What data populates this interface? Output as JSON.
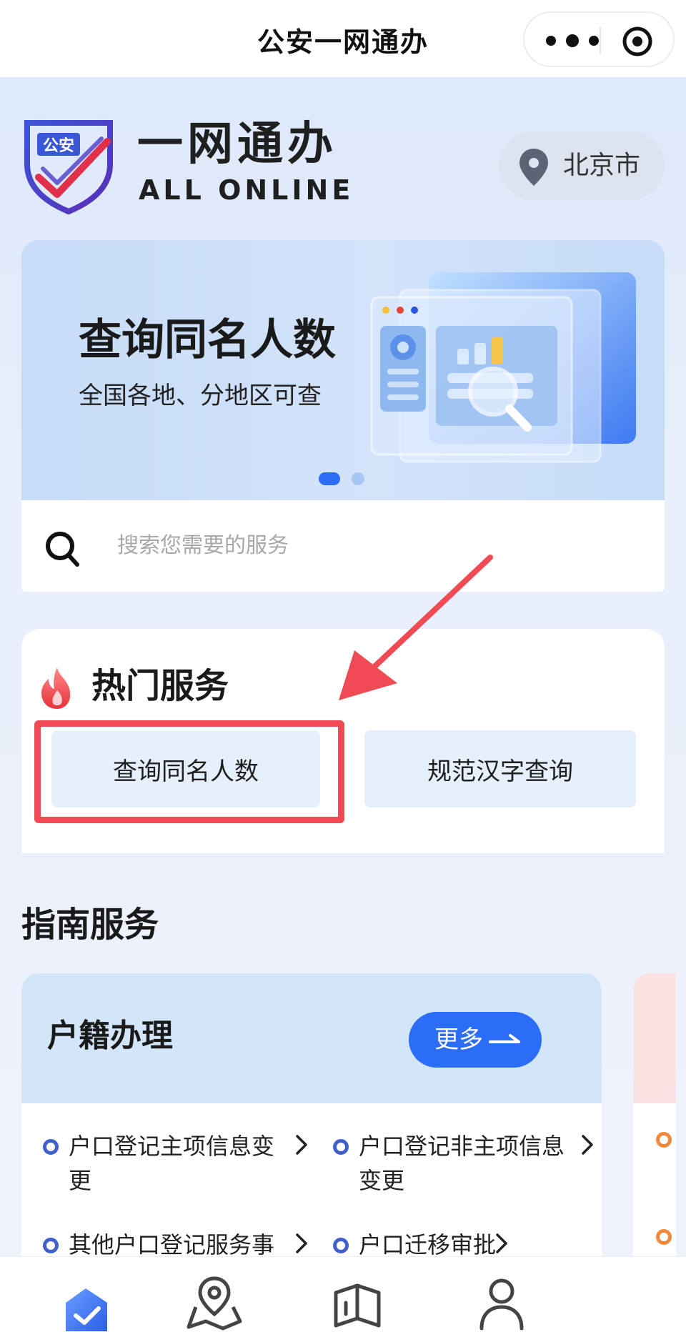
{
  "app": {
    "title": "公安一网通办"
  },
  "header": {
    "brand_cn": "一网通办",
    "brand_en": "ALL ONLINE",
    "logo_text": "公安",
    "city": "北京市"
  },
  "banner": {
    "title": "查询同名人数",
    "subtitle": "全国各地、分地区可查",
    "active_slide": 1,
    "slides_count": 2
  },
  "search": {
    "placeholder": "搜索您需要的服务"
  },
  "hot_services": {
    "title": "热门服务",
    "items": [
      {
        "label": "查询同名人数",
        "highlighted": true
      },
      {
        "label": "规范汉字查询",
        "highlighted": false
      }
    ]
  },
  "guide": {
    "title": "指南服务",
    "cards": [
      {
        "title": "户籍办理",
        "more_label": "更多",
        "items": [
          {
            "label": "户口登记主项信息变更"
          },
          {
            "label": "户口登记非主项信息变更"
          },
          {
            "label": "其他户口登记服务事"
          },
          {
            "label": "户口迁移审批"
          }
        ]
      }
    ]
  },
  "tabbar": {
    "items": [
      {
        "icon": "home-check-icon",
        "active": true
      },
      {
        "icon": "map-pin-icon",
        "active": false
      },
      {
        "icon": "book-icon",
        "active": false
      },
      {
        "icon": "user-icon",
        "active": false
      }
    ]
  },
  "colors": {
    "accent": "#2c6df7",
    "highlight_red": "#f04b55",
    "bullet_blue": "#3f5fcc",
    "bullet_orange": "#f08a3a"
  }
}
